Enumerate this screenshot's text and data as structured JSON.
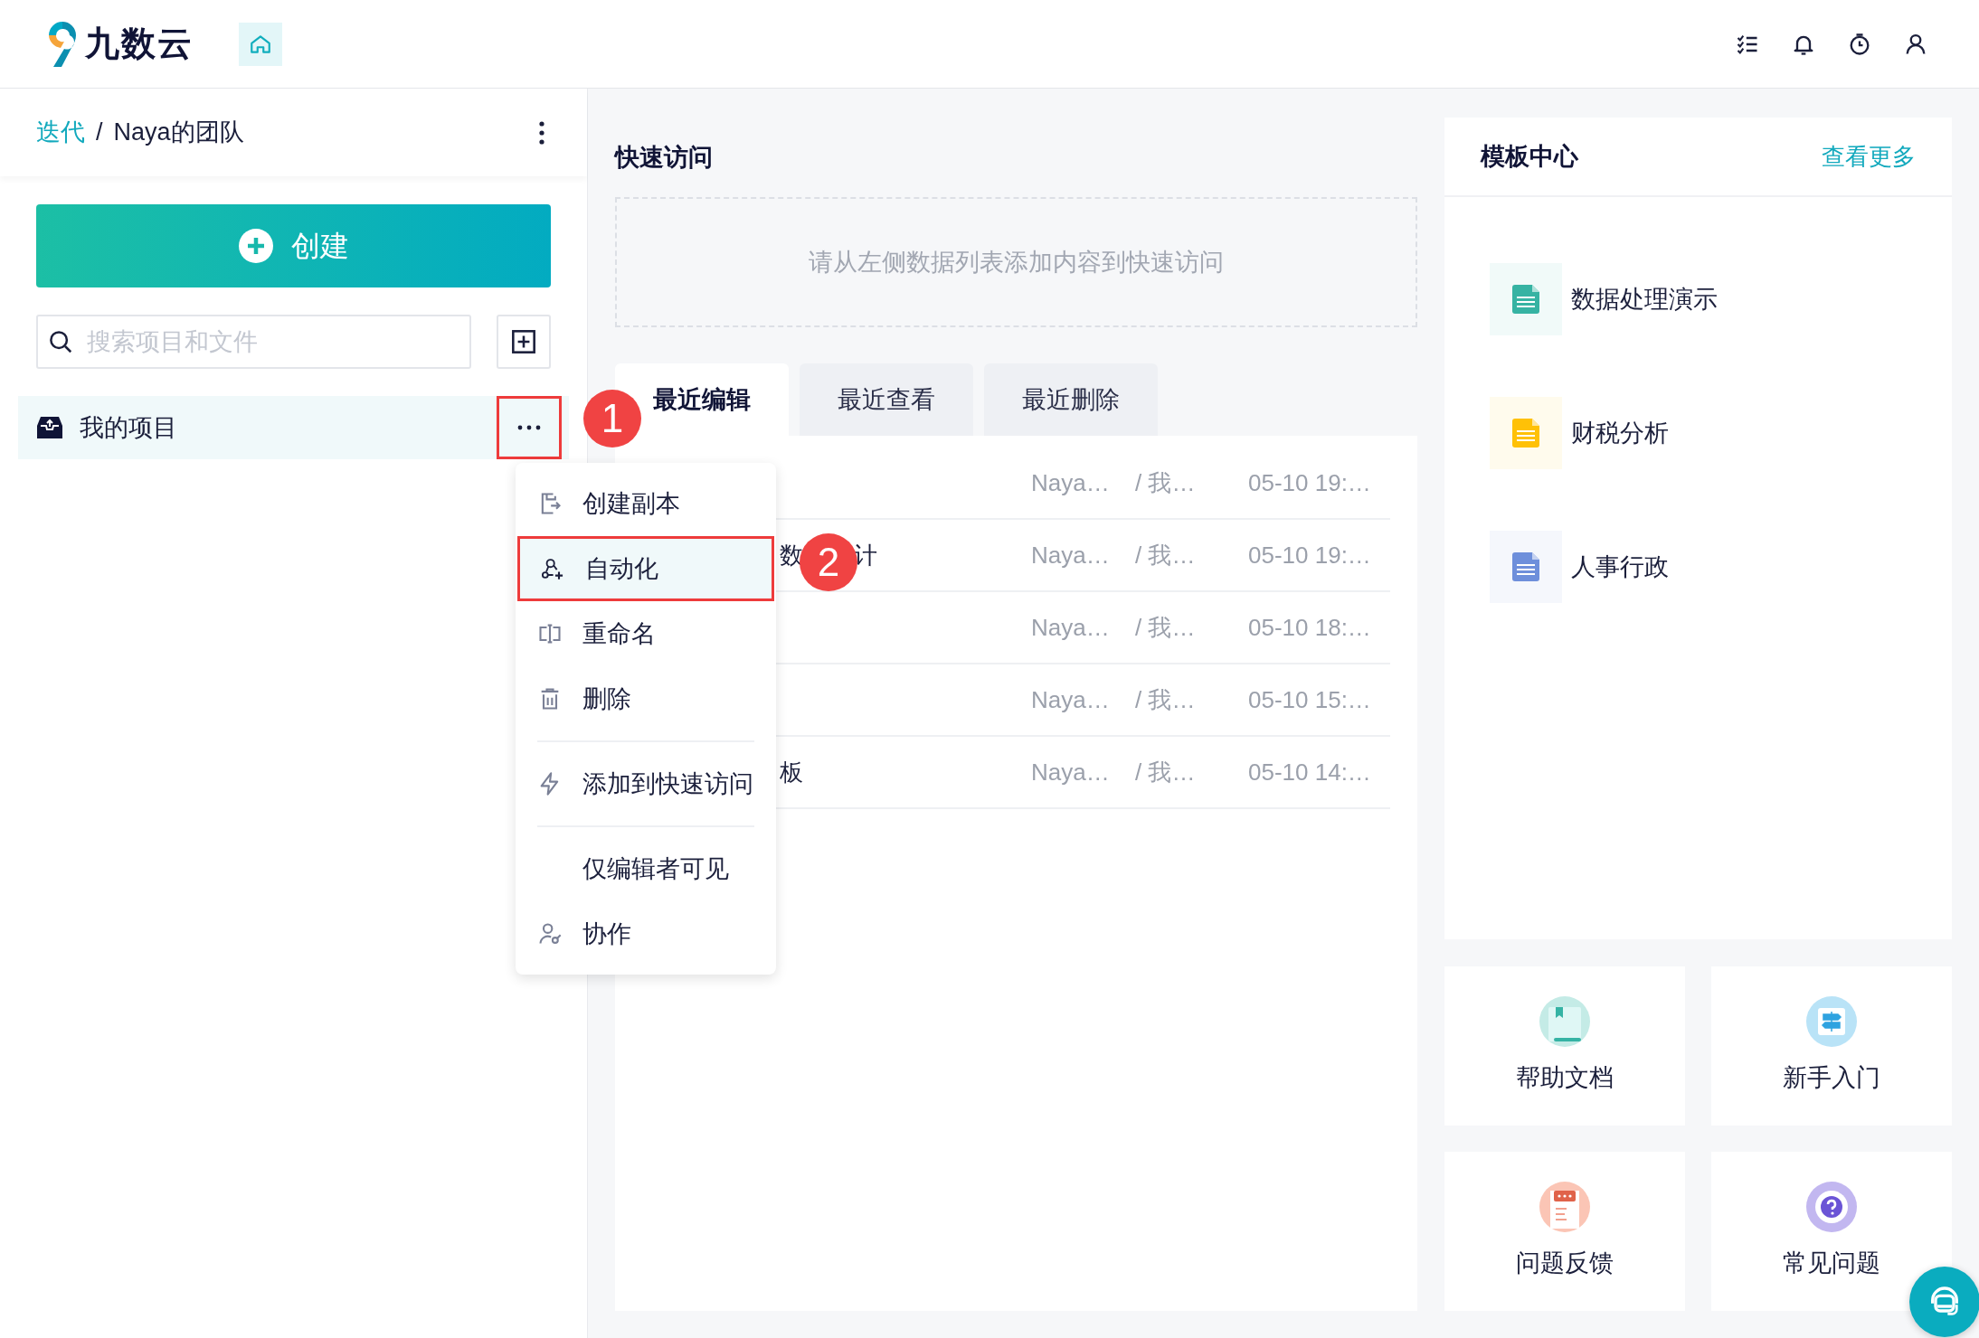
{
  "header": {
    "logo_text": "九数云"
  },
  "sidebar": {
    "breadcrumb": [
      {
        "text": "迭代",
        "kind": "link"
      },
      {
        "text": "/",
        "kind": "separator"
      },
      {
        "text": "Naya的团队",
        "kind": "current"
      }
    ],
    "create_button": "创建",
    "search": {
      "placeholder": "搜索项目和文件"
    },
    "items": [
      {
        "label": "我的项目",
        "selected": true
      }
    ]
  },
  "context_menu": {
    "items": [
      {
        "kind": "item",
        "label": "创建副本",
        "selected": false
      },
      {
        "kind": "item",
        "label": "自动化",
        "selected": true
      },
      {
        "kind": "item",
        "label": "重命名",
        "selected": false
      },
      {
        "kind": "item",
        "label": "删除",
        "selected": false
      },
      {
        "kind": "divider"
      },
      {
        "kind": "item",
        "label": "添加到快速访问",
        "selected": false
      },
      {
        "kind": "divider"
      },
      {
        "kind": "item",
        "label": "仅编辑者可见",
        "selected": false
      },
      {
        "kind": "item",
        "label": "协作",
        "selected": false
      }
    ]
  },
  "callouts": [
    {
      "text": "1"
    },
    {
      "text": "2"
    }
  ],
  "quick_access": {
    "title": "快速访问",
    "empty_text": "请从左侧数据列表添加内容到快速访问"
  },
  "recent": {
    "tabs": [
      {
        "label": "最近编辑",
        "selected": true
      },
      {
        "label": "最近查看",
        "selected": false
      },
      {
        "label": "最近删除",
        "selected": false
      }
    ],
    "rows": [
      {
        "owner": "Naya…",
        "path": "/ 我…",
        "time": "05-10 19:…"
      },
      {
        "name_parts": [
          "数",
          "计"
        ],
        "owner": "Naya…",
        "path": "/ 我…",
        "time": "05-10 19:…"
      },
      {
        "owner": "Naya…",
        "path": "/ 我…",
        "time": "05-10 18:…"
      },
      {
        "owner": "Naya…",
        "path": "/ 我…",
        "time": "05-10 15:…"
      },
      {
        "name_parts": [
          "板"
        ],
        "owner": "Naya…",
        "path": "/ 我…",
        "time": "05-10 14:…"
      }
    ]
  },
  "templates": {
    "title": "模板中心",
    "more": "查看更多",
    "items": [
      {
        "label": "数据处理演示",
        "color": "#36b3a3"
      },
      {
        "label": "财税分析",
        "color": "#ffc107"
      },
      {
        "label": "人事行政",
        "color": "#6e8fdb"
      }
    ]
  },
  "help_cards": [
    {
      "label": "帮助文档"
    },
    {
      "label": "新手入门"
    },
    {
      "label": "问题反馈"
    },
    {
      "label": "常见问题"
    }
  ]
}
